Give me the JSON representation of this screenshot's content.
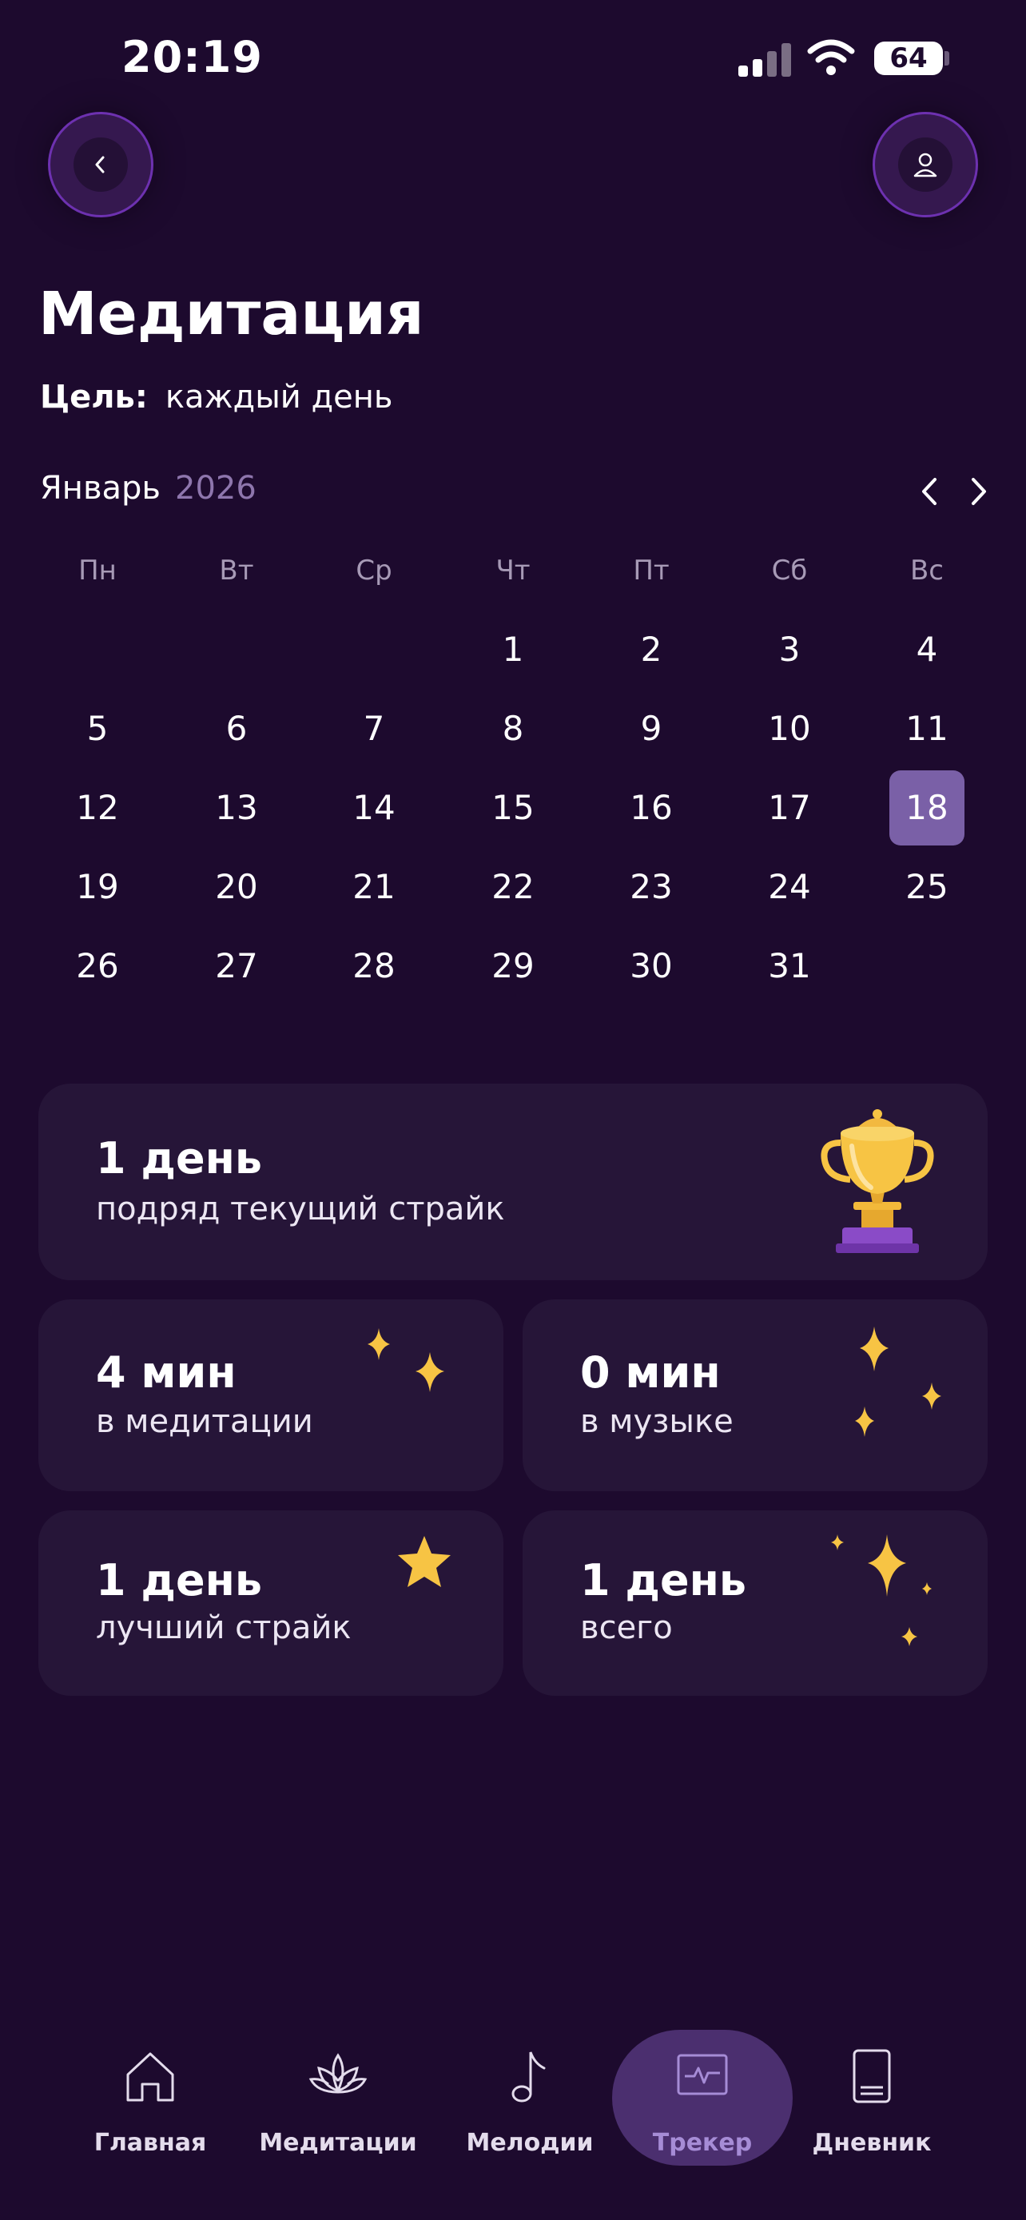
{
  "status_bar": {
    "time": "20:19",
    "battery": "64"
  },
  "header": {
    "title": "Медитация",
    "goal_label": "Цель:",
    "goal_value": "каждый день"
  },
  "calendar": {
    "month": "Январь",
    "year": "2026",
    "weekdays": [
      "Пн",
      "Вт",
      "Ср",
      "Чт",
      "Пт",
      "Сб",
      "Вс"
    ],
    "weeks": [
      [
        "",
        "",
        "",
        "1",
        "2",
        "3",
        "4"
      ],
      [
        "5",
        "6",
        "7",
        "8",
        "9",
        "10",
        "11"
      ],
      [
        "12",
        "13",
        "14",
        "15",
        "16",
        "17",
        "18"
      ],
      [
        "19",
        "20",
        "21",
        "22",
        "23",
        "24",
        "25"
      ],
      [
        "26",
        "27",
        "28",
        "29",
        "30",
        "31",
        ""
      ]
    ],
    "today": "18",
    "today_color": "#7a60a7"
  },
  "stats": {
    "streak": {
      "value": "1 день",
      "label": "подряд текущий страйк"
    },
    "meditation": {
      "value": "4 мин",
      "label": "в медитации"
    },
    "music": {
      "value": "0 мин",
      "label": "в музыке"
    },
    "best": {
      "value": "1 день",
      "label": "лучший страйк"
    },
    "total": {
      "value": "1 день",
      "label": "всего"
    }
  },
  "tabbar": {
    "items": [
      {
        "label": "Главная",
        "icon": "home-icon"
      },
      {
        "label": "Медитации",
        "icon": "lotus-icon"
      },
      {
        "label": "Мелодии",
        "icon": "music-note-icon"
      },
      {
        "label": "Трекер",
        "icon": "tracker-icon"
      },
      {
        "label": "Дневник",
        "icon": "notebook-icon"
      }
    ],
    "active_index": 3
  },
  "colors": {
    "background": "#1d0a2e",
    "card": "#261538",
    "accent": "#7a60a7",
    "gold": "#f7c444"
  }
}
